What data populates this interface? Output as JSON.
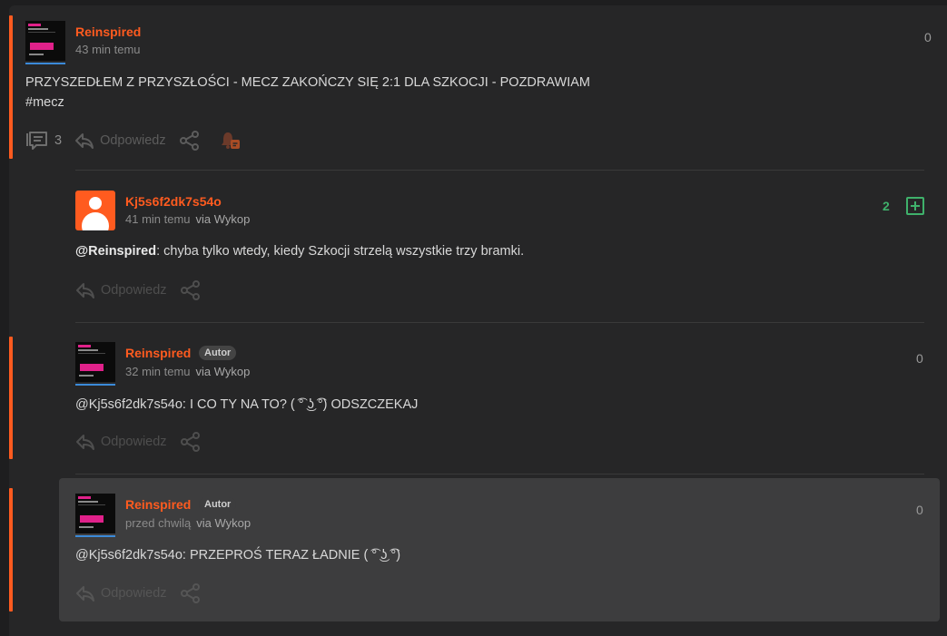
{
  "post": {
    "author": "Reinspired",
    "time": "43 min temu",
    "score": "0",
    "text": "PRZYSZEDŁEM Z PRZYSZŁOŚCI - MECZ ZAKOŃCZY SIĘ 2:1 DLA SZKOCJI - POZDRAWIAM",
    "tag": "#mecz",
    "comments_count": "3",
    "reply_label": "Odpowiedz"
  },
  "comments": [
    {
      "author": "Kj5s6f2dk7s54o",
      "time": "41 min temu",
      "via": "via Wykop",
      "score": "2",
      "mention": "@Reinspired",
      "text": ": chyba tylko wtedy, kiedy Szkocji strzelą wszystkie trzy bramki.",
      "reply_label": "Odpowiedz"
    },
    {
      "author": "Reinspired",
      "badge": "Autor",
      "time": "32 min temu",
      "via": "via Wykop",
      "score": "0",
      "mention": "@Kj5s6f2dk7s54o",
      "text": ": I CO TY NA TO? ( ͡° ͜ʖ ͡°) ODSZCZEKAJ",
      "reply_label": "Odpowiedz"
    },
    {
      "author": "Reinspired",
      "badge": "Autor",
      "time": "przed chwilą",
      "via": "via Wykop",
      "score": "0",
      "mention": "@Kj5s6f2dk7s54o",
      "text": ": PRZEPROŚ TERAZ ŁADNIE ( ͡° ͜ʖ ͡°)",
      "reply_label": "Odpowiedz"
    }
  ],
  "colors": {
    "accent": "#ff5b1f",
    "upvote_green": "#3fb16b",
    "background": "#262627",
    "highlight": "#3d3d3e"
  },
  "icons": [
    "comments-icon",
    "reply-icon",
    "share-icon",
    "bell-icon",
    "plus-icon"
  ]
}
